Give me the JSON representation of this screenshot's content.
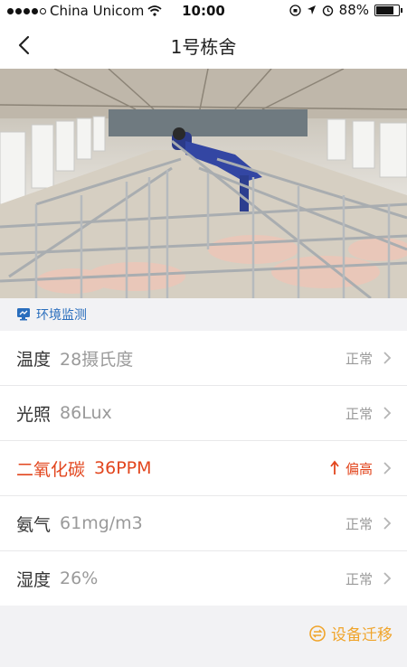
{
  "status_bar": {
    "carrier": "China Unicom",
    "time": "10:00",
    "battery": "88%",
    "battery_level": 0.88
  },
  "nav": {
    "title": "1号栋舍",
    "back_icon": "chevron-left-icon"
  },
  "hero": {
    "image_subject": "barn-photo"
  },
  "section": {
    "title": "环境监测",
    "icon": "monitor-icon"
  },
  "readings": [
    {
      "name": "温度",
      "value": "28摄氏度",
      "status": "正常",
      "alert": false
    },
    {
      "name": "光照",
      "value": "86Lux",
      "status": "正常",
      "alert": false
    },
    {
      "name": "二氧化碳",
      "value": "36PPM",
      "status": "偏高",
      "alert": true
    },
    {
      "name": "氨气",
      "value": "61mg/m3",
      "status": "正常",
      "alert": false
    },
    {
      "name": "湿度",
      "value": "26%",
      "status": "正常",
      "alert": false
    }
  ],
  "footer": {
    "migrate_label": "设备迁移"
  },
  "colors": {
    "accent_blue": "#2a6ebd",
    "alert_red": "#e2461e",
    "migrate_orange": "#f0a42a"
  }
}
